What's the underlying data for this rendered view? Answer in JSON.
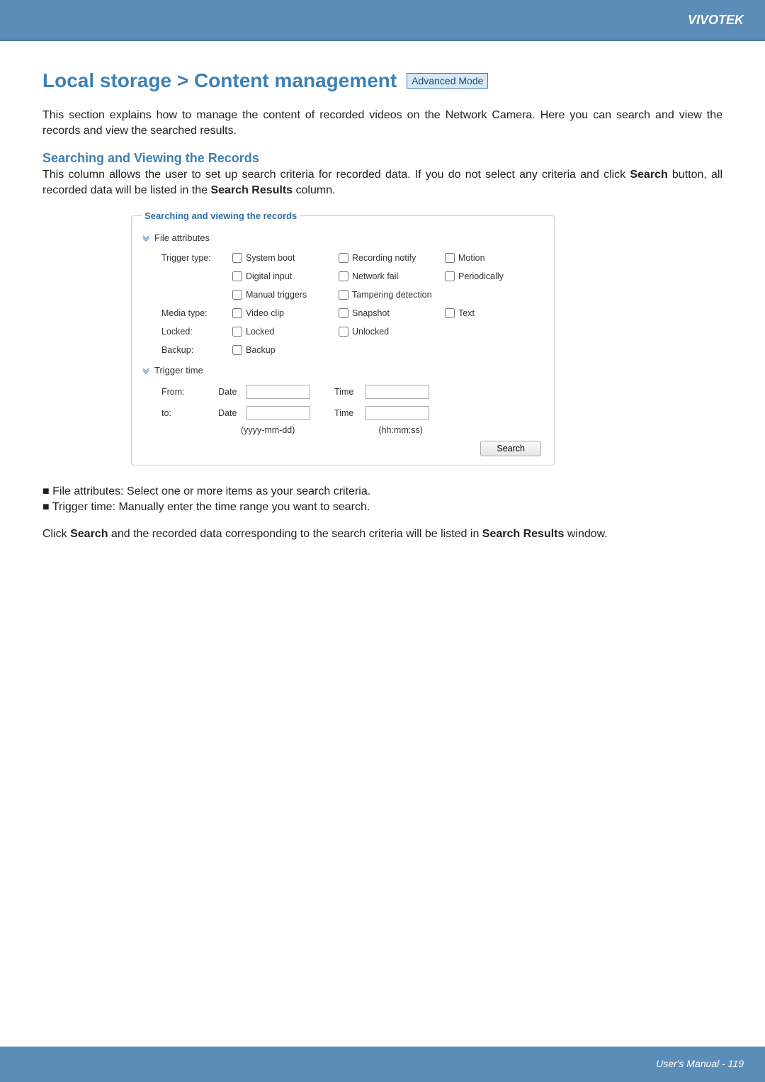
{
  "brand": "VIVOTEK",
  "footer": "User's Manual - 119",
  "heading": "Local storage > Content management",
  "mode_badge": "Advanced Mode",
  "intro": "This section explains how to manage the content of recorded videos on the Network Camera. Here you can search and view the records and view the searched results.",
  "subheading": "Searching and Viewing the Records",
  "subtext_pre": "This column allows the user to set up search criteria for recorded data. If you do not select any criteria and click ",
  "subtext_bold1": "Search",
  "subtext_mid": " button, all recorded data will be listed in the ",
  "subtext_bold2": "Search Results",
  "subtext_post": " column.",
  "panel": {
    "legend": "Searching and viewing the records",
    "file_attr_title": "File attributes",
    "trigger_time_title": "Trigger time",
    "rows": {
      "trigger_type_label": "Trigger type:",
      "media_type_label": "Media type:",
      "locked_label": "Locked:",
      "backup_label": "Backup:"
    },
    "cb": {
      "system_boot": "System boot",
      "recording_notify": "Recording notify",
      "motion": "Motion",
      "digital_input": "Digital input",
      "network_fail": "Network fail",
      "periodically": "Periodically",
      "manual_triggers": "Manual triggers",
      "tampering_detection": "Tampering detection",
      "video_clip": "Video clip",
      "snapshot": "Snapshot",
      "text": "Text",
      "locked": "Locked",
      "unlocked": "Unlocked",
      "backup": "Backup"
    },
    "dates": {
      "from_label": "From:",
      "to_label": "to:",
      "date_word": "Date",
      "time_word": "Time",
      "date_hint": "(yyyy-mm-dd)",
      "time_hint": "(hh:mm:ss)"
    },
    "search_btn": "Search"
  },
  "bullets": {
    "b1": "■ File attributes: Select one or more items as your search criteria.",
    "b2": "■ Trigger time: Manually enter the time range you want to search."
  },
  "outro_pre": "Click ",
  "outro_bold1": "Search",
  "outro_mid": " and the recorded data corresponding to the search criteria will be listed in ",
  "outro_bold2": "Search Results",
  "outro_post": " window."
}
